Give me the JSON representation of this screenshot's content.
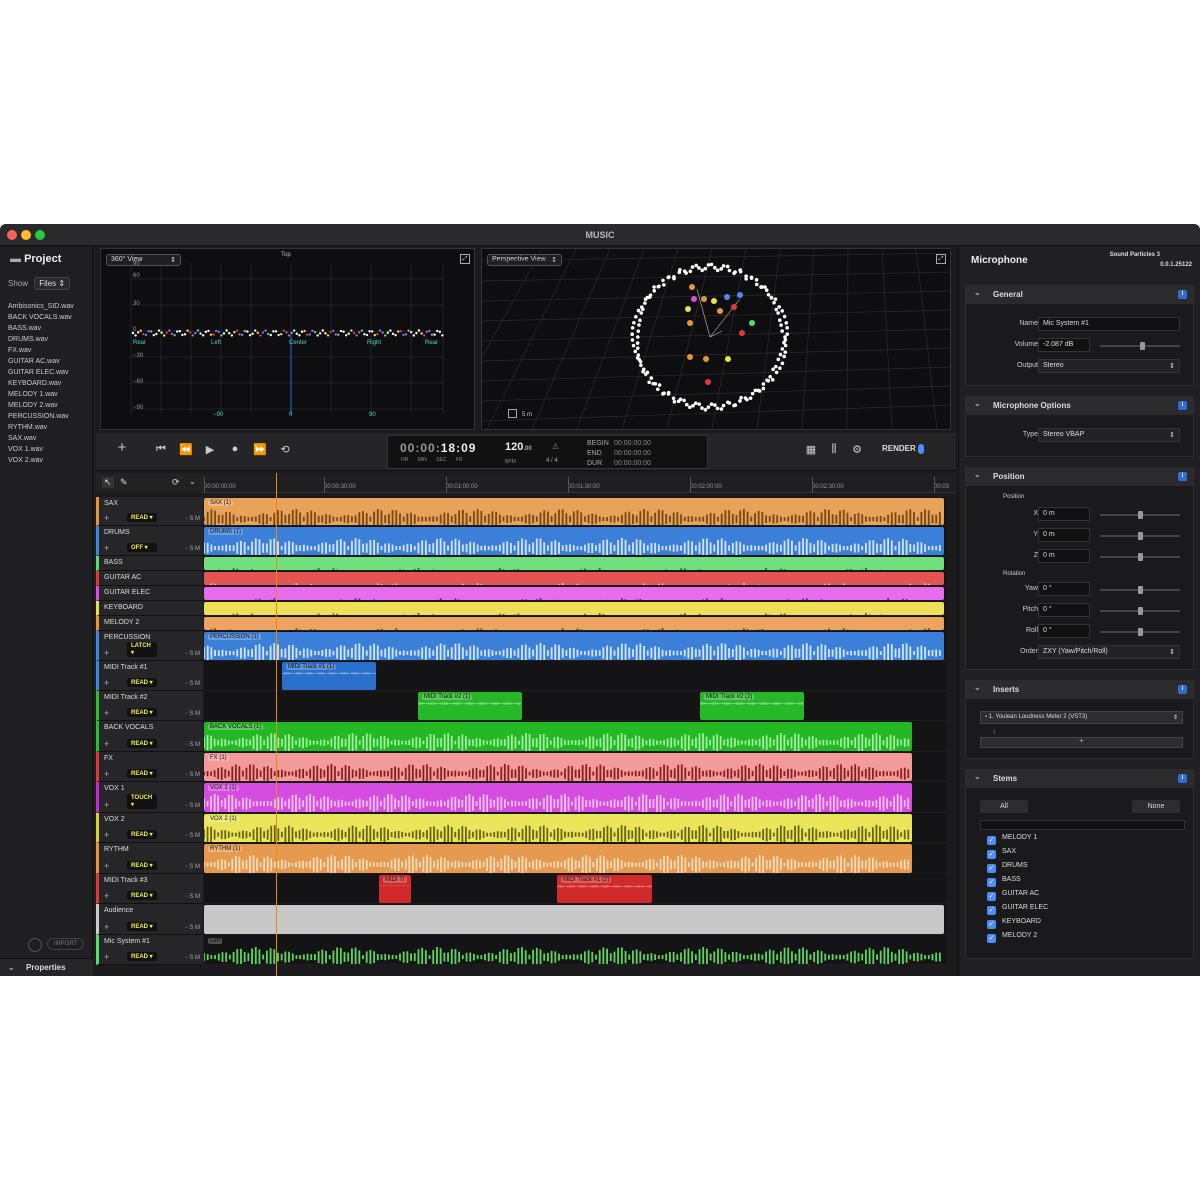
{
  "window": {
    "title": "MUSIC"
  },
  "project": {
    "title": "Project",
    "show_label": "Show",
    "show_value": "Files",
    "files": [
      "Ambisonics_SID.wav",
      "BACK VOCALS.wav",
      "BASS.wav",
      "DRUMS.wav",
      "FX.wav",
      "GUITAR AC.wav",
      "GUITAR ELEC.wav",
      "KEYBOARD.wav",
      "MELODY 1.wav",
      "MELODY 2.wav",
      "PERCUSSION.wav",
      "RYTHM.wav",
      "SAX.wav",
      "VOX 1.wav",
      "VOX 2.wav"
    ],
    "import_label": "IMPORT",
    "properties_label": "Properties"
  },
  "view360": {
    "select": "360° View",
    "top_label": "Top",
    "y_ticks": [
      "90",
      "60",
      "30",
      "0",
      "−30",
      "−60",
      "−90"
    ],
    "x_labels": [
      "Rear",
      "Left",
      "Center",
      "Right",
      "Rear"
    ],
    "x_ticks": [
      "−90",
      "0",
      "90"
    ]
  },
  "perspective": {
    "select": "Perspective View",
    "scale_label": "5 m"
  },
  "transport": {
    "time": {
      "hr": "00",
      "min": "00",
      "sec": "18",
      "fr": "09",
      "hr_l": "HR",
      "min_l": "MIN",
      "sec_l": "SEC",
      "fr_l": "FR"
    },
    "bpm": "120",
    "bpm_dec": ".00",
    "bpm_label": "BPM",
    "sig": "4 / 4",
    "begin_label": "BEGIN",
    "end_label": "END",
    "dur_label": "DUR",
    "begin": "00:00:00:00",
    "end": "00:00:00:00",
    "dur": "00:00:00:00",
    "render_label": "RENDER"
  },
  "ruler": [
    "00:00:00:00",
    "00:00:30:00",
    "00:01:00:00",
    "00:01:30:00",
    "00:02:00:00",
    "00:02:30:00",
    "00:03"
  ],
  "tracks": [
    {
      "name": "SAX",
      "mode": "READ",
      "color": "#e8953a"
    },
    {
      "name": "DRUMS",
      "mode": "OFF",
      "color": "#3d86e8"
    },
    {
      "name": "BASS",
      "mode": "",
      "color": "#4fe06d"
    },
    {
      "name": "GUITAR AC",
      "mode": "",
      "color": "#e03a3a"
    },
    {
      "name": "GUITAR ELEC",
      "mode": "",
      "color": "#e04ae8"
    },
    {
      "name": "KEYBOARD",
      "mode": "",
      "color": "#e8e24a"
    },
    {
      "name": "MELODY 2",
      "mode": "",
      "color": "#e8953a"
    },
    {
      "name": "PERCUSSION",
      "mode": "LATCH",
      "color": "#3d86e8"
    },
    {
      "name": "MIDI Track #1",
      "mode": "READ",
      "color": "#3d86e8"
    },
    {
      "name": "MIDI Track #2",
      "mode": "READ",
      "color": "#2cc02c"
    },
    {
      "name": "BACK VOCALS",
      "mode": "READ",
      "color": "#2cc02c"
    },
    {
      "name": "FX",
      "mode": "READ",
      "color": "#e03a3a"
    },
    {
      "name": "VOX 1",
      "mode": "TOUCH",
      "color": "#c02cd0"
    },
    {
      "name": "VOX 2",
      "mode": "READ",
      "color": "#d8d030"
    },
    {
      "name": "RYTHM",
      "mode": "READ",
      "color": "#e8953a"
    },
    {
      "name": "MIDI Track #3",
      "mode": "READ",
      "color": "#e03a3a"
    },
    {
      "name": "Audience",
      "mode": "READ",
      "color": "#cccccc"
    },
    {
      "name": "Mic System #1",
      "mode": "READ",
      "color": "#4fe06d"
    }
  ],
  "clips": {
    "sax": "SAX (1)",
    "drums": "DRUMS (1)",
    "perc": "PERCUSSION (1)",
    "midi1": "MIDI Track #1 (1)",
    "midi2a": "MIDI Track #2 (1)",
    "midi2b": "MIDI Track #2 (2)",
    "backv": "BACK VOCALS (1)",
    "fx": "FX (1)",
    "vox1": "VOX 1 (1)",
    "vox2": "VOX 2 (1)",
    "rythm": "RYTHM (1)",
    "midi3a": "MIDI Tr",
    "midi3b": "MIDI Track #1 (2)",
    "left": "Left",
    "right": "Right"
  },
  "inspector": {
    "title": "Microphone",
    "app": "Sound Particles 3",
    "version": "0.0.1.25122",
    "general": {
      "title": "General",
      "name_l": "Name",
      "name": "Mic System #1",
      "volume_l": "Volume",
      "volume": "-2.087 dB",
      "output_l": "Output",
      "output": "Stereo"
    },
    "mic_options": {
      "title": "Microphone Options",
      "type_l": "Type",
      "type": "Stereo VBAP"
    },
    "position": {
      "title": "Position",
      "pos_l": "Position",
      "x_l": "X",
      "x": "0 m",
      "y_l": "Y",
      "y": "0 m",
      "z_l": "Z",
      "z": "0 m",
      "rot_l": "Rotation",
      "yaw_l": "Yaw",
      "yaw": "0 °",
      "pitch_l": "Pitch",
      "pitch": "0 °",
      "roll_l": "Roll",
      "roll": "0 °",
      "order_l": "Order",
      "order": "ZXY (Yaw/Pitch/Roll)"
    },
    "inserts": {
      "title": "Inserts",
      "plugin": "1. Youlean Loudness Meter 2 (VST3)",
      "add": "+"
    },
    "stems": {
      "title": "Stems",
      "all": "All",
      "none": "None",
      "items": [
        "MELODY 1",
        "SAX",
        "DRUMS",
        "BASS",
        "GUITAR AC",
        "GUITAR ELEC",
        "KEYBOARD",
        "MELODY 2"
      ]
    }
  }
}
